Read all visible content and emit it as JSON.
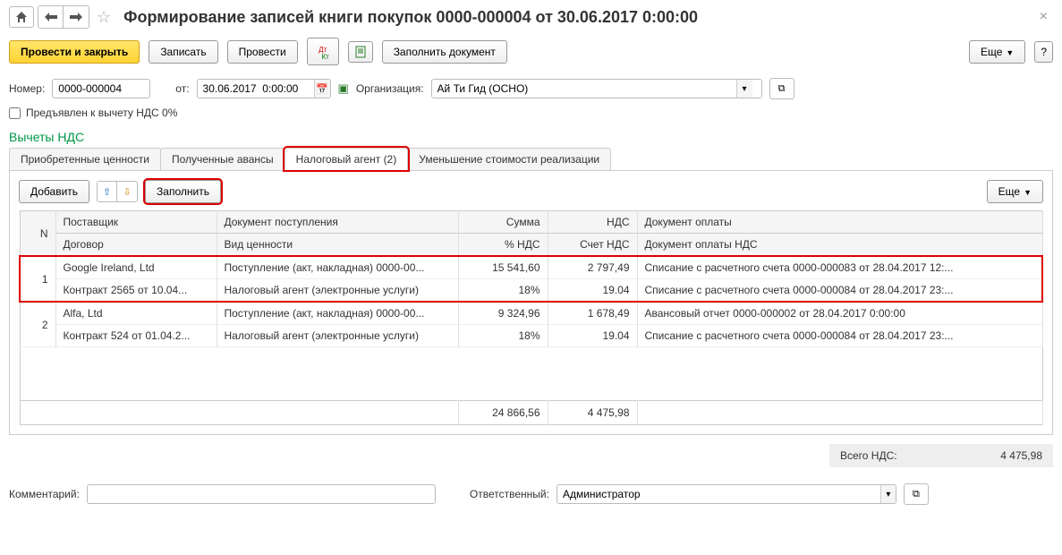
{
  "header": {
    "title": "Формирование записей книги покупок 0000-000004 от 30.06.2017 0:00:00"
  },
  "actions": {
    "post_close": "Провести и закрыть",
    "write": "Записать",
    "post": "Провести",
    "fill_doc": "Заполнить документ",
    "more": "Еще"
  },
  "form": {
    "number_label": "Номер:",
    "number_value": "0000-000004",
    "date_label": "от:",
    "date_value": "30.06.2017  0:00:00",
    "org_label": "Организация:",
    "org_value": "Ай Ти Гид (ОСНО)",
    "vat_checkbox": "Предъявлен к вычету НДС 0%"
  },
  "section": {
    "title": "Вычеты НДС"
  },
  "tabs": {
    "t1": "Приобретенные ценности",
    "t2": "Полученные авансы",
    "t3": "Налоговый агент (2)",
    "t4": "Уменьшение стоимости реализации"
  },
  "tab_toolbar": {
    "add": "Добавить",
    "fill": "Заполнить",
    "more": "Еще"
  },
  "grid": {
    "head": {
      "n": "N",
      "supplier": "Поставщик",
      "contract": "Договор",
      "receipt_doc": "Документ поступления",
      "value_type": "Вид ценности",
      "sum": "Сумма",
      "vat_pct": "% НДС",
      "vat": "НДС",
      "vat_acc": "Счет НДС",
      "pay_doc": "Документ оплаты",
      "pay_doc_vat": "Документ оплаты НДС"
    },
    "rows": [
      {
        "n": "1",
        "supplier": "Google Ireland, Ltd",
        "contract": "Контракт 2565 от 10.04...",
        "receipt_doc": "Поступление (акт, накладная) 0000-00...",
        "value_type": "Налоговый агент (электронные услуги)",
        "sum": "15 541,60",
        "vat_pct": "18%",
        "vat": "2 797,49",
        "vat_acc": "19.04",
        "pay_doc": "Списание с расчетного счета 0000-000083 от 28.04.2017 12:...",
        "pay_doc_vat": "Списание с расчетного счета 0000-000084 от 28.04.2017 23:..."
      },
      {
        "n": "2",
        "supplier": "Alfa, Ltd",
        "contract": "Контракт 524 от 01.04.2...",
        "receipt_doc": "Поступление (акт, накладная) 0000-00...",
        "value_type": "Налоговый агент (электронные услуги)",
        "sum": "9 324,96",
        "vat_pct": "18%",
        "vat": "1 678,49",
        "vat_acc": "19.04",
        "pay_doc": "Авансовый отчет 0000-000002 от 28.04.2017 0:00:00",
        "pay_doc_vat": "Списание с расчетного счета 0000-000084 от 28.04.2017 23:..."
      }
    ],
    "totals": {
      "sum": "24 866,56",
      "vat": "4 475,98"
    }
  },
  "totals_bar": {
    "label": "Всего НДС:",
    "value": "4 475,98"
  },
  "footer": {
    "comment_label": "Комментарий:",
    "responsible_label": "Ответственный:",
    "responsible_value": "Администратор"
  }
}
